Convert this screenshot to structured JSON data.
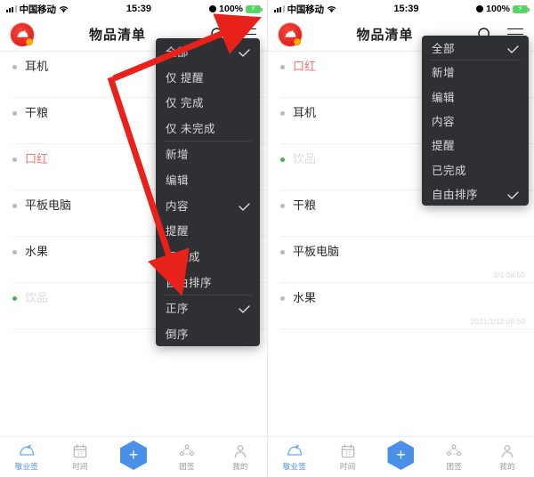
{
  "status_bar": {
    "carrier": "中国移动",
    "time": "15:39",
    "battery_percent": "100%",
    "wifi_icon": "wifi-icon",
    "signal_icon": "signal-bars-icon",
    "alarm_icon": "alarm-clock-icon",
    "battery_icon": "battery-charging-icon"
  },
  "header": {
    "title": "物品清单",
    "logo_icon": "app-logo-icon",
    "search_icon": "search-icon",
    "menu_icon": "hamburger-menu-icon"
  },
  "left_panel": {
    "list": [
      {
        "text": "耳机",
        "style": "normal",
        "dot": "grey",
        "stamp": ""
      },
      {
        "text": "干粮",
        "style": "normal",
        "dot": "grey",
        "stamp": ""
      },
      {
        "text": "口红",
        "style": "red",
        "dot": "grey",
        "stamp": ""
      },
      {
        "text": "平板电脑",
        "style": "normal",
        "dot": "grey",
        "stamp": ""
      },
      {
        "text": "水果",
        "style": "normal",
        "dot": "grey",
        "stamp": ""
      },
      {
        "text": "饮品",
        "style": "muted",
        "dot": "green",
        "stamp": ""
      }
    ],
    "menu": {
      "items": [
        {
          "label": "全部",
          "checked": true,
          "separator": false
        },
        {
          "label": "仅 提醒",
          "checked": false,
          "separator": false
        },
        {
          "label": "仅 完成",
          "checked": false,
          "separator": false
        },
        {
          "label": "仅 未完成",
          "checked": false,
          "separator": false
        },
        {
          "label": "新增",
          "checked": false,
          "separator": true
        },
        {
          "label": "编辑",
          "checked": false,
          "separator": false
        },
        {
          "label": "内容",
          "checked": true,
          "separator": false
        },
        {
          "label": "提醒",
          "checked": false,
          "separator": false
        },
        {
          "label": "已完成",
          "checked": false,
          "separator": false
        },
        {
          "label": "自由排序",
          "checked": false,
          "separator": false
        },
        {
          "label": "正序",
          "checked": true,
          "separator": true
        },
        {
          "label": "倒序",
          "checked": false,
          "separator": false
        }
      ]
    }
  },
  "right_panel": {
    "list": [
      {
        "text": "口红",
        "style": "red",
        "dot": "grey",
        "stamp": ""
      },
      {
        "text": "耳机",
        "style": "normal",
        "dot": "grey",
        "stamp": ""
      },
      {
        "text": "饮品",
        "style": "muted",
        "dot": "green",
        "stamp": ""
      },
      {
        "text": "干粮",
        "style": "normal",
        "dot": "grey",
        "stamp": ""
      },
      {
        "text": "平板电脑",
        "style": "normal",
        "dot": "grey",
        "stamp": "3/1 08:55"
      },
      {
        "text": "水果",
        "style": "normal",
        "dot": "grey",
        "stamp": "2021/1/12 09:50"
      }
    ],
    "menu": {
      "items": [
        {
          "label": "全部",
          "checked": true,
          "separator": false
        },
        {
          "label": "新增",
          "checked": false,
          "separator": true
        },
        {
          "label": "编辑",
          "checked": false,
          "separator": false
        },
        {
          "label": "内容",
          "checked": false,
          "separator": false
        },
        {
          "label": "提醒",
          "checked": false,
          "separator": false
        },
        {
          "label": "已完成",
          "checked": false,
          "separator": false
        },
        {
          "label": "自由排序",
          "checked": true,
          "separator": false
        }
      ]
    }
  },
  "tabbar": {
    "items": [
      {
        "label": "敬业签",
        "icon": "cloud-bird-icon",
        "active": true
      },
      {
        "label": "时间",
        "icon": "calendar-icon",
        "active": false
      },
      {
        "label": "团签",
        "icon": "team-icon",
        "active": false
      },
      {
        "label": "我的",
        "icon": "person-icon",
        "active": false
      }
    ],
    "add_button": {
      "label": "+",
      "icon": "plus-hexagon-icon"
    }
  },
  "colors": {
    "accent_blue": "#4a90e8",
    "brand_red": "#e0231c",
    "menu_bg": "#2f3033",
    "item_red": "#f4756e",
    "dot_green": "#4caf50",
    "annotation_red": "#e8211a"
  }
}
